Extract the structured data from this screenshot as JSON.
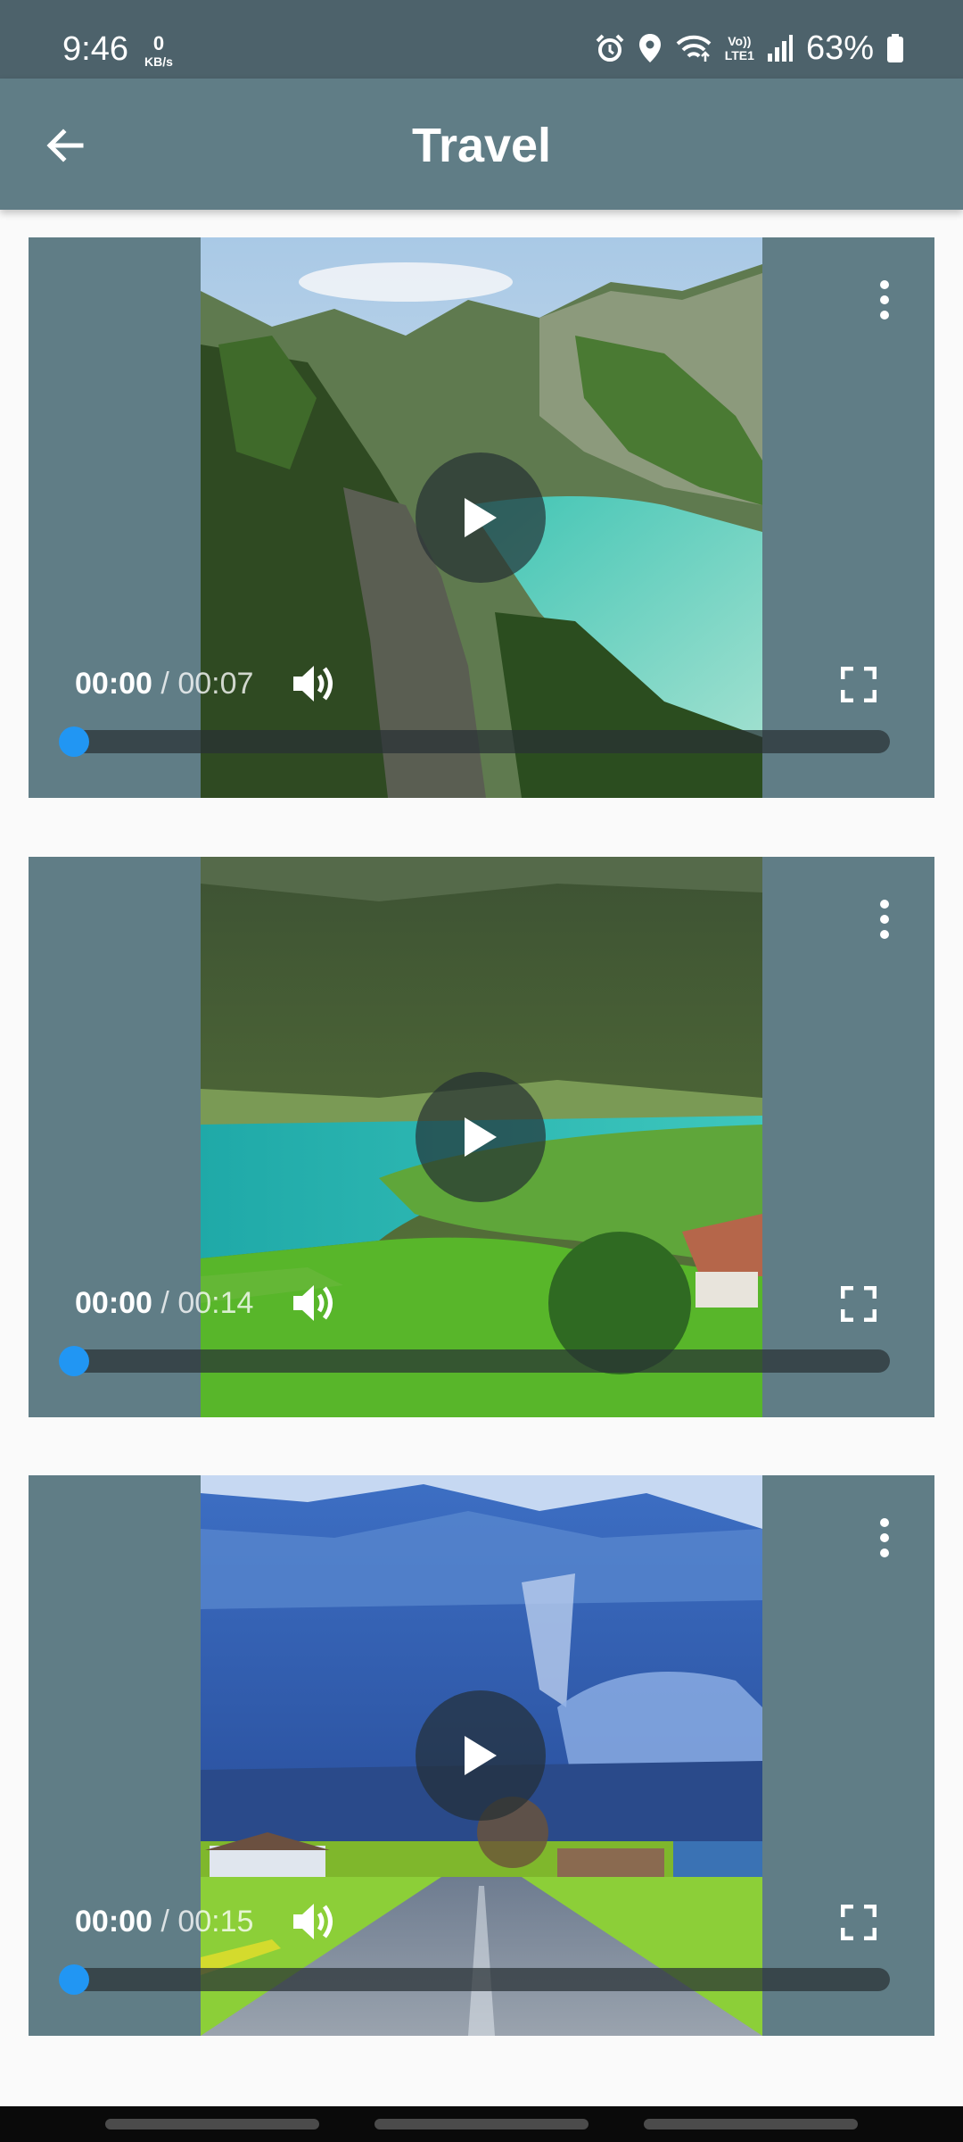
{
  "status_bar": {
    "time": "9:46",
    "net_speed_value": "0",
    "net_speed_unit": "KB/s",
    "lte_top": "Vo))",
    "lte_bottom": "LTE1",
    "battery": "63%",
    "icons": [
      "alarm-icon",
      "location-icon",
      "wifi-icon",
      "signal-icon",
      "battery-icon"
    ]
  },
  "app_bar": {
    "title": "Travel",
    "back_icon": "arrow-back-icon",
    "background": "#607d86"
  },
  "videos": [
    {
      "scene": "tropical-bay",
      "current_time": "00:00",
      "separator": " / ",
      "duration": "00:07",
      "progress": 0.0
    },
    {
      "scene": "alpine-lake",
      "current_time": "00:00",
      "separator": " / ",
      "duration": "00:14",
      "progress": 0.0
    },
    {
      "scene": "snowy-valley-road",
      "current_time": "00:00",
      "separator": " / ",
      "duration": "00:15",
      "progress": 0.0
    }
  ],
  "colors": {
    "accent": "#2196f3",
    "card_background": "#607d86",
    "status_bar": "#4d626b",
    "page_background": "#fafafa"
  }
}
